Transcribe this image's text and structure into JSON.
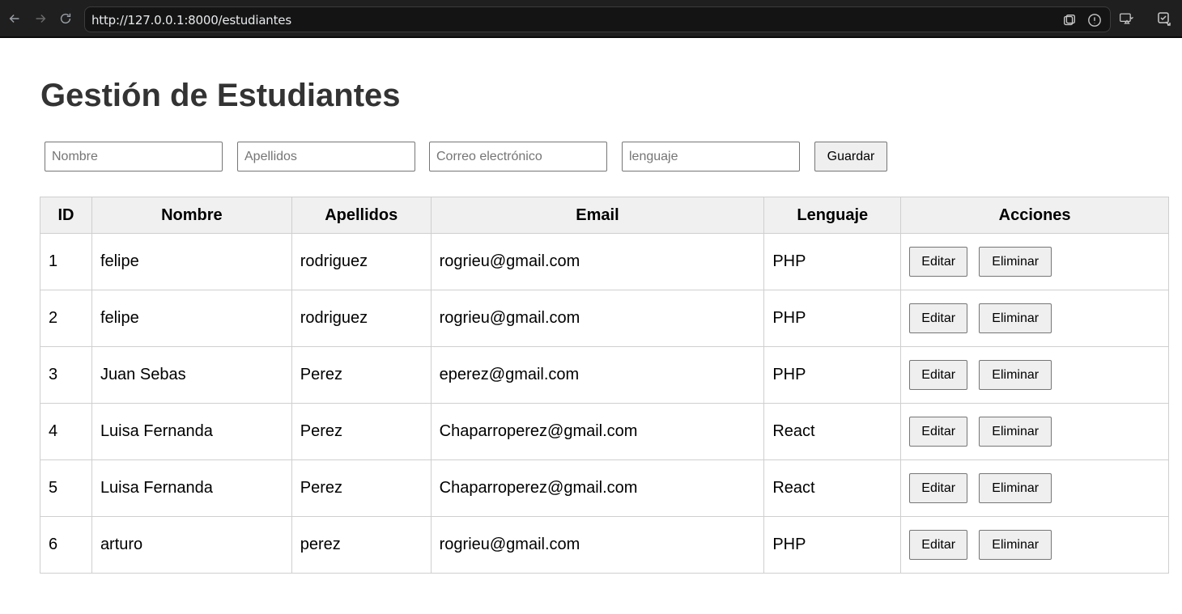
{
  "browser": {
    "url": "http://127.0.0.1:8000/estudiantes"
  },
  "page": {
    "title": "Gestión de Estudiantes"
  },
  "form": {
    "nombre_placeholder": "Nombre",
    "apellidos_placeholder": "Apellidos",
    "email_placeholder": "Correo electrónico",
    "lenguaje_placeholder": "lenguaje",
    "save_label": "Guardar"
  },
  "table": {
    "headers": [
      "ID",
      "Nombre",
      "Apellidos",
      "Email",
      "Lenguaje",
      "Acciones"
    ],
    "edit_label": "Editar",
    "delete_label": "Eliminar",
    "rows": [
      {
        "id": "1",
        "nombre": "felipe",
        "apellidos": "rodriguez",
        "email": "rogrieu@gmail.com",
        "lenguaje": "PHP"
      },
      {
        "id": "2",
        "nombre": "felipe",
        "apellidos": "rodriguez",
        "email": "rogrieu@gmail.com",
        "lenguaje": "PHP"
      },
      {
        "id": "3",
        "nombre": "Juan Sebas",
        "apellidos": "Perez",
        "email": "eperez@gmail.com",
        "lenguaje": "PHP"
      },
      {
        "id": "4",
        "nombre": "Luisa Fernanda",
        "apellidos": "Perez",
        "email": "Chaparroperez@gmail.com",
        "lenguaje": "React"
      },
      {
        "id": "5",
        "nombre": "Luisa Fernanda",
        "apellidos": "Perez",
        "email": "Chaparroperez@gmail.com",
        "lenguaje": "React"
      },
      {
        "id": "6",
        "nombre": "arturo",
        "apellidos": "perez",
        "email": "rogrieu@gmail.com",
        "lenguaje": "PHP"
      }
    ]
  },
  "icons": {
    "back": "arrow-left-icon",
    "forward": "arrow-right-icon",
    "reload": "reload-icon",
    "tabs": "tab-search-icon",
    "info": "site-info-icon",
    "cast": "cast-icon",
    "extensions": "extensions-icon"
  },
  "colors": {
    "chrome_bg": "#1f1f1f",
    "title_text": "#333333",
    "header_bg": "#f0f0f0",
    "button_bg": "#efefef"
  }
}
